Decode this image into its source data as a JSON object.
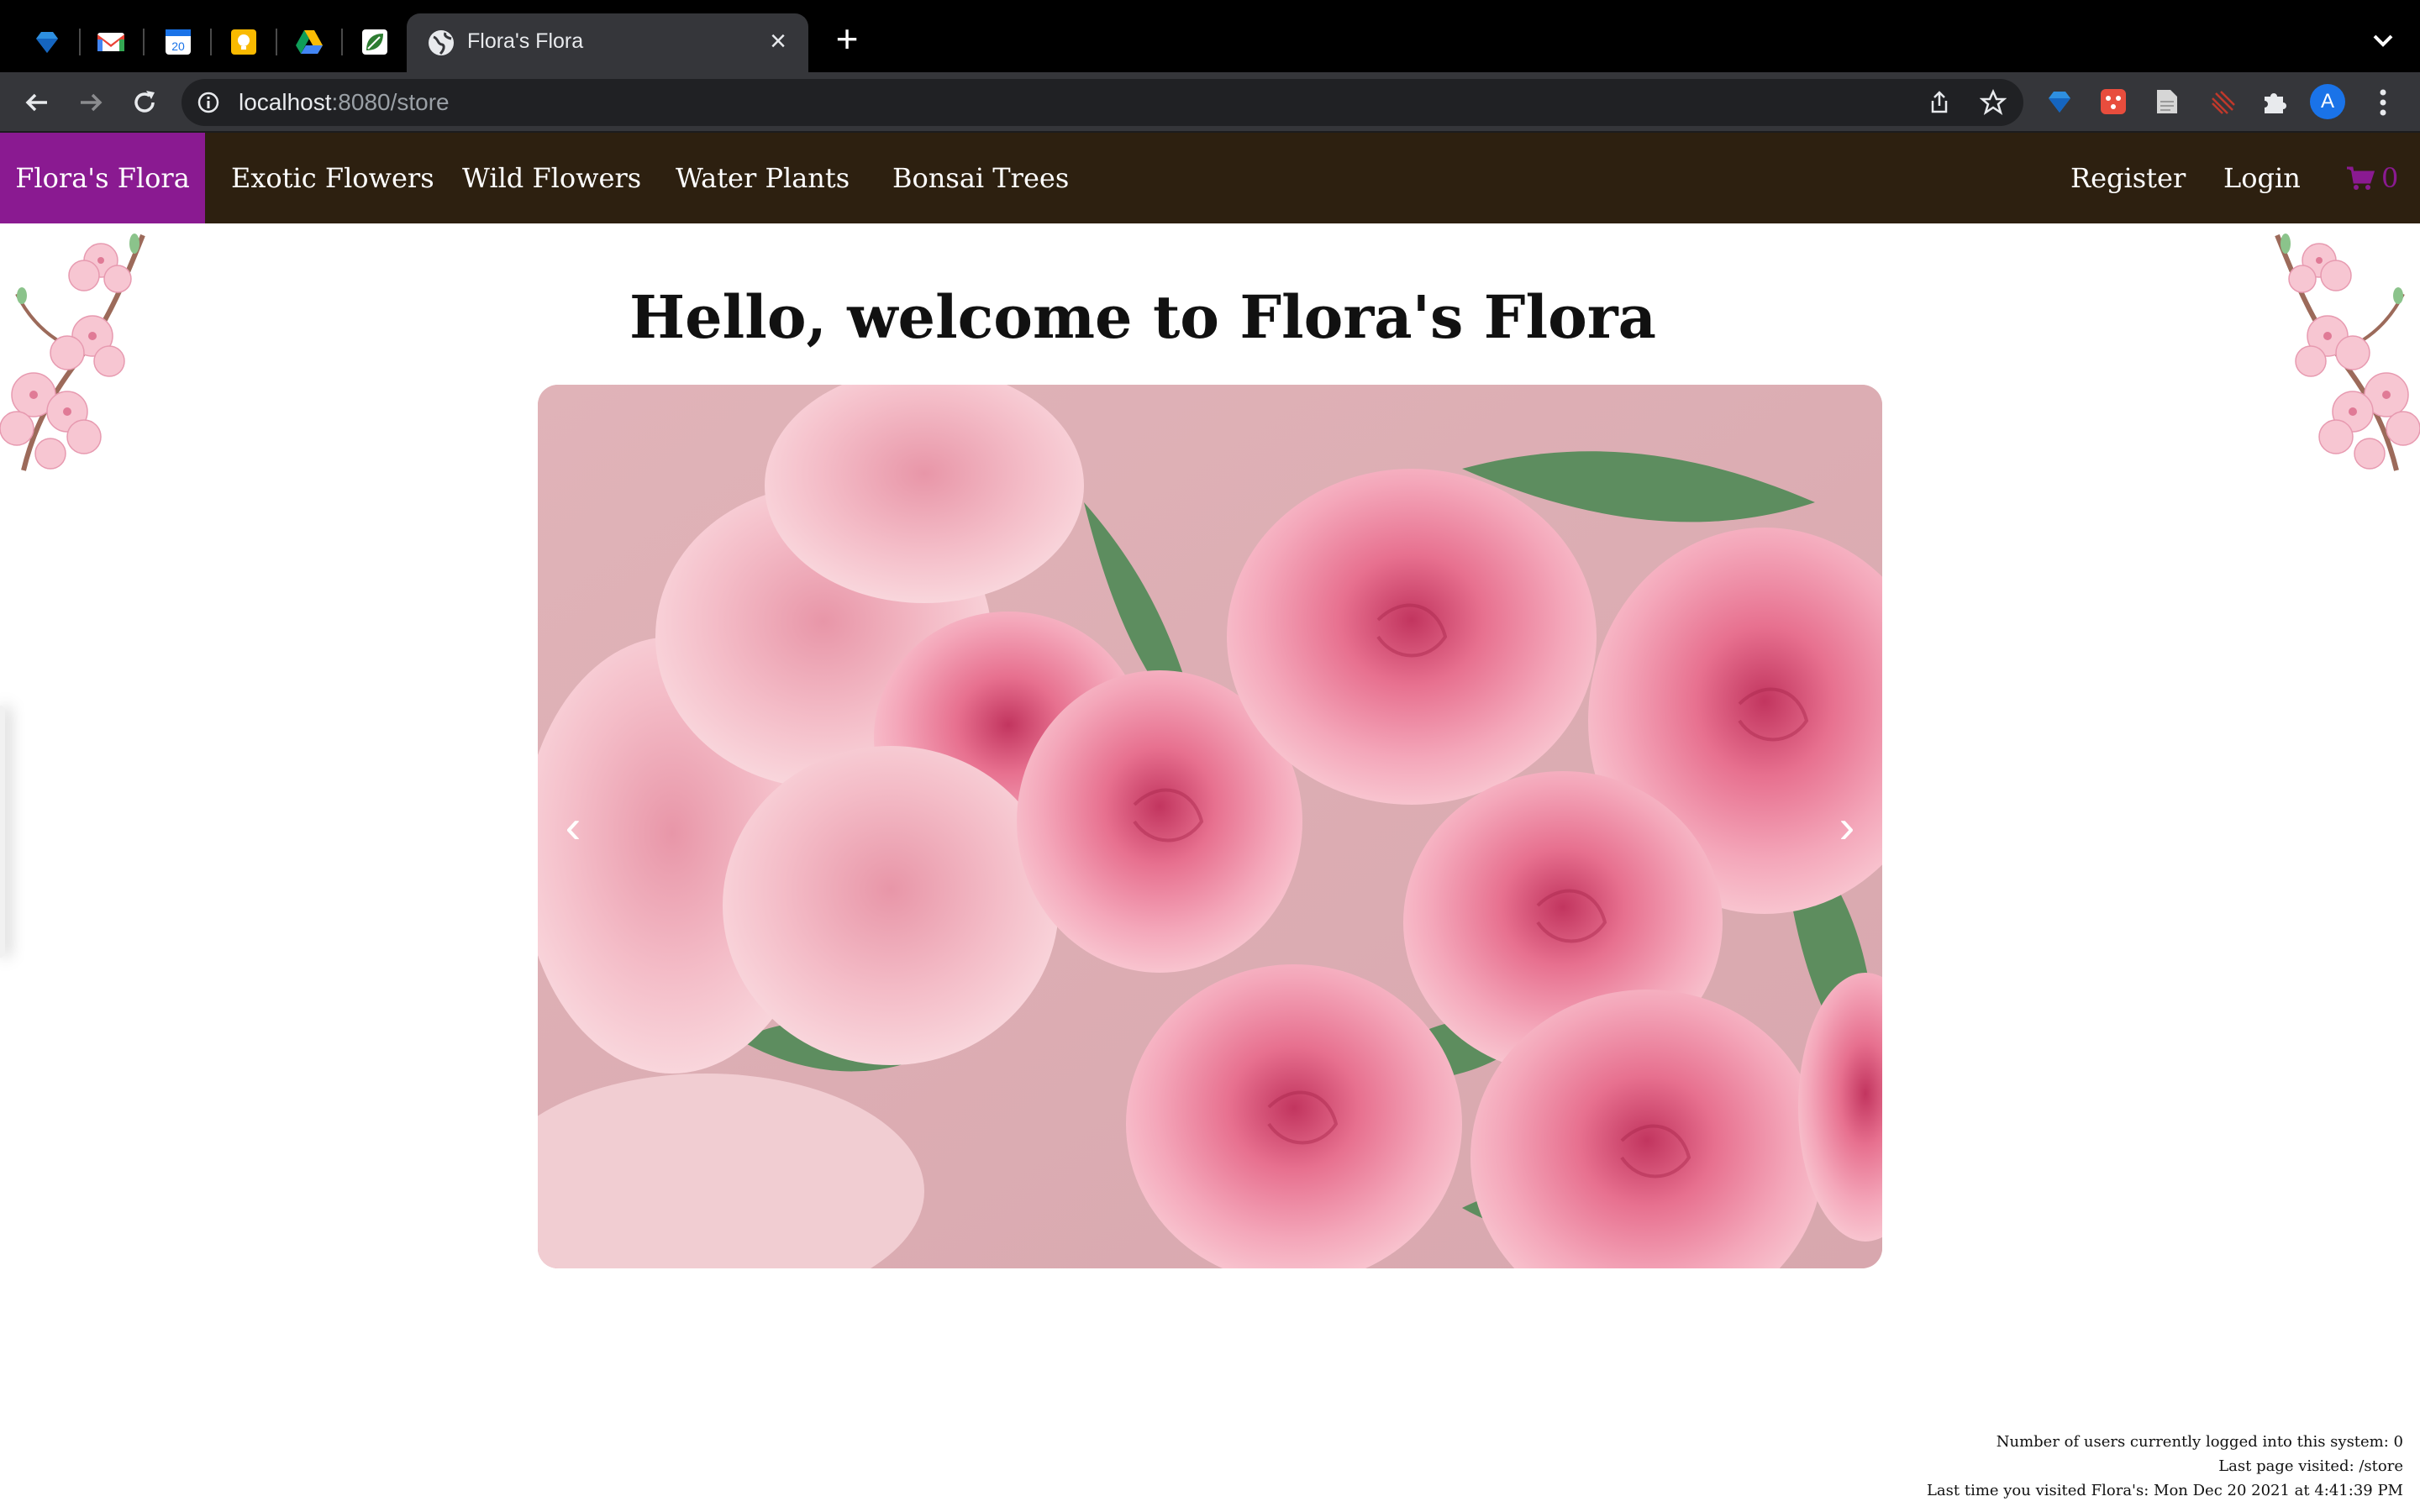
{
  "browser": {
    "pinned_tabs": [
      {
        "icon": "gem-icon",
        "color": "#2e8fe0"
      },
      {
        "icon": "gmail-icon",
        "color": "#ea4335"
      },
      {
        "icon": "calendar-icon",
        "color": "#1a73e8",
        "label": "20"
      },
      {
        "icon": "keep-icon",
        "color": "#f9ba00"
      },
      {
        "icon": "drive-icon",
        "color": "#0f9d58"
      },
      {
        "icon": "leaf-icon",
        "color": "#2e7d32"
      }
    ],
    "active_tab": {
      "title": "Flora's Flora"
    },
    "url": {
      "host": "localhost",
      "rest": ":8080/store"
    },
    "profile_initial": "A"
  },
  "nav": {
    "brand": "Flora's Flora",
    "links": [
      "Exotic Flowers",
      "Wild Flowers",
      "Water Plants",
      "Bonsai Trees"
    ],
    "register": "Register",
    "login": "Login",
    "cart_count": "0"
  },
  "main": {
    "welcome": "Hello, welcome to Flora's Flora",
    "carousel": {
      "prev": "‹",
      "next": "›",
      "image": "pink-roses-bouquet"
    }
  },
  "footer": {
    "users": "Number of users currently logged into this system: 0",
    "last_page": "Last page visited: /store",
    "last_visit": "Last time you visited Flora's: Mon Dec 20 2021 at 4:41:39 PM"
  },
  "colors": {
    "nav_bg": "#2d2010",
    "brand_bg": "#8a1a91",
    "cart": "#8a1a91"
  }
}
